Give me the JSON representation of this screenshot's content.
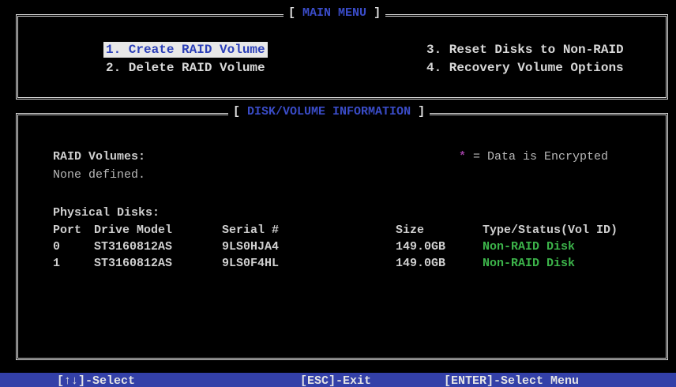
{
  "main_menu": {
    "title_open": "[",
    "title": "MAIN MENU",
    "title_close": "]",
    "items": [
      {
        "label": "1. Create RAID Volume"
      },
      {
        "label": "2. Delete RAID Volume"
      },
      {
        "label": "3. Reset Disks to Non-RAID"
      },
      {
        "label": "4. Recovery Volume Options"
      }
    ]
  },
  "disk_info": {
    "title_open": "[",
    "title": "DISK/VOLUME INFORMATION",
    "title_close": "]",
    "raid_volumes_label": "RAID Volumes:",
    "raid_volumes_value": "None defined.",
    "encrypted_star": "*",
    "encrypted_note": "= Data is Encrypted",
    "physical_disks_label": "Physical Disks:",
    "columns": {
      "port": "Port",
      "model": "Drive Model",
      "serial": "Serial #",
      "size": "Size",
      "status": "Type/Status(Vol ID)"
    },
    "disks": [
      {
        "port": "0",
        "model": "ST3160812AS",
        "serial": "9LS0HJA4",
        "size": "149.0GB",
        "status": "Non-RAID Disk"
      },
      {
        "port": "1",
        "model": "ST3160812AS",
        "serial": "9LS0F4HL",
        "size": "149.0GB",
        "status": "Non-RAID Disk"
      }
    ]
  },
  "footer": {
    "select": "[↑↓]-Select",
    "exit": "[ESC]-Exit",
    "enter": "[ENTER]-Select Menu"
  },
  "colors": {
    "background": "#000000",
    "accent_blue": "#3340a8",
    "status_green": "#3cb44a",
    "encrypt_purple": "#9b3ea0"
  }
}
